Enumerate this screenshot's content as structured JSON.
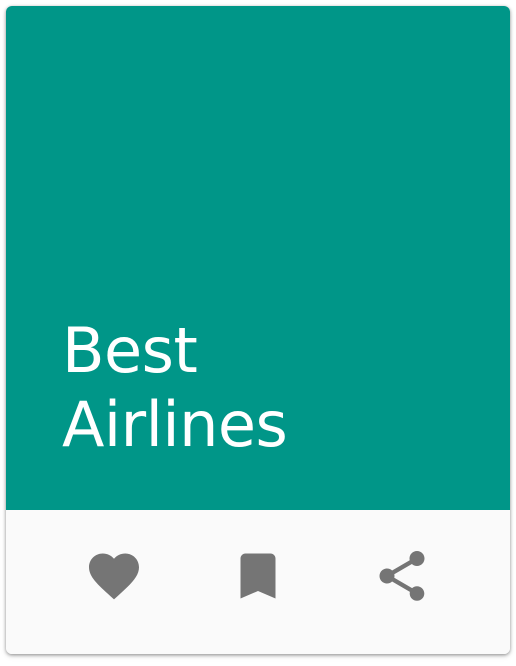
{
  "card": {
    "title_line1": "Best",
    "title_line2": "Airlines",
    "media_color": "#009688"
  },
  "actions": [
    {
      "name": "favorite",
      "icon": "heart-icon",
      "color": "#757575"
    },
    {
      "name": "bookmark",
      "icon": "bookmark-icon",
      "color": "#757575"
    },
    {
      "name": "share",
      "icon": "share-icon",
      "color": "#757575"
    }
  ]
}
